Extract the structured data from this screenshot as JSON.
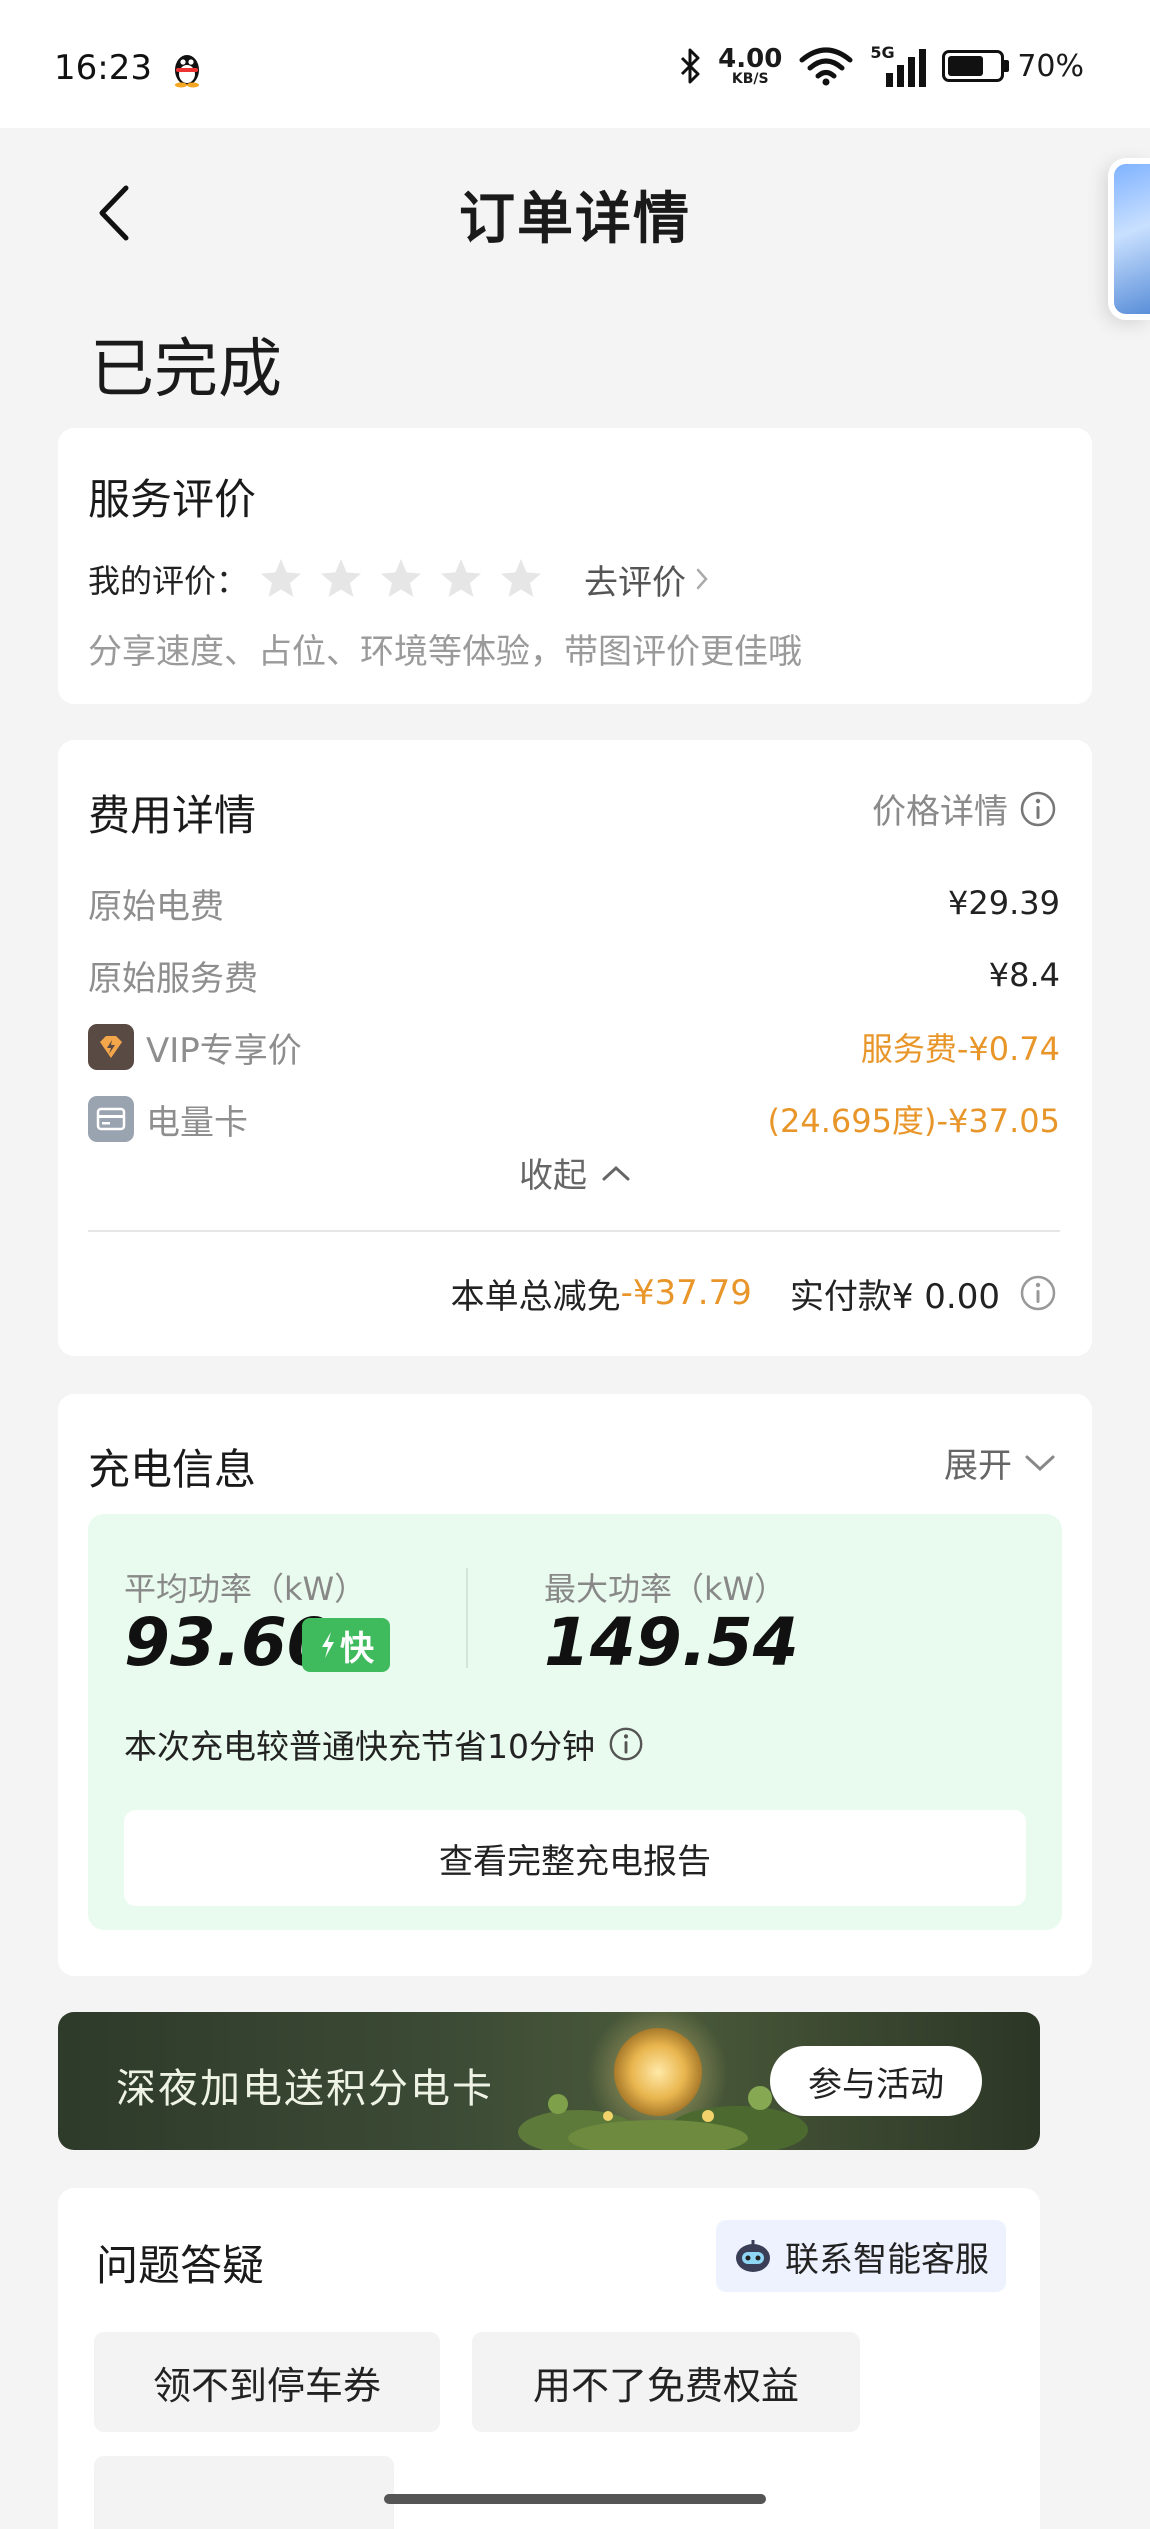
{
  "status_bar": {
    "time": "16:23",
    "net_speed_value": "4.00",
    "net_speed_unit": "KB/S",
    "network": "5G",
    "battery": "70%",
    "battery_level": 0.7
  },
  "nav": {
    "title": "订单详情",
    "back_icon": "chevron-left-icon"
  },
  "order": {
    "status": "已完成"
  },
  "review": {
    "title": "服务评价",
    "my_rating_label": "我的评价：",
    "rating": 0,
    "max_rating": 5,
    "go_review": "去评价",
    "hint": "分享速度、占位、环境等体验，带图评价更佳哦"
  },
  "fee": {
    "title": "费用详情",
    "price_detail": "价格详情",
    "rows": [
      {
        "label": "原始电费",
        "value": "¥29.39",
        "icon": ""
      },
      {
        "label": "原始服务费",
        "value": "¥8.4",
        "icon": ""
      },
      {
        "label": "VIP专享价",
        "value": "服务费-¥0.74",
        "icon": "vip-lightning-icon"
      },
      {
        "label": "电量卡",
        "value": "(24.695度)-¥37.05",
        "icon": "card-icon"
      }
    ],
    "collapse": "收起",
    "total_discount_label": "本单总减免",
    "total_discount_value": "-¥37.79",
    "paid_label": "实付款¥ 0.00"
  },
  "charge": {
    "title": "充电信息",
    "expand": "展开",
    "avg_power_label": "平均功率（kW）",
    "avg_power_value": "93.60",
    "fast_badge": "快",
    "max_power_label": "最大功率（kW）",
    "max_power_value": "149.54",
    "save_note": "本次充电较普通快充节省10分钟",
    "report_button": "查看完整充电报告"
  },
  "banner": {
    "text": "深夜加电送积分电卡",
    "button": "参与活动"
  },
  "faq": {
    "title": "问题答疑",
    "agent_button": "联系智能客服",
    "chips": [
      "领不到停车券",
      "用不了免费权益"
    ]
  },
  "colors": {
    "accent_orange": "#e8962a",
    "fast_green": "#3fba5c",
    "power_panel_bg": "#e9fbee",
    "page_bg": "#f4f4f4"
  }
}
